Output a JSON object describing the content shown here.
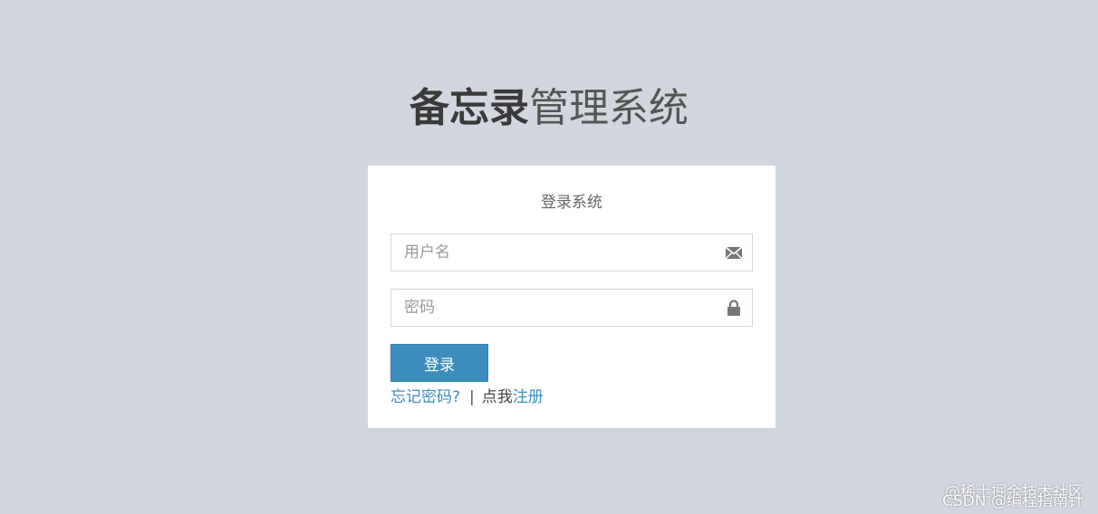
{
  "logo": {
    "bold": "备忘录",
    "light": "管理系统"
  },
  "login_box": {
    "message": "登录系统",
    "username": {
      "placeholder": "用户名",
      "value": "",
      "icon": "envelope-icon"
    },
    "password": {
      "placeholder": "密码",
      "value": "",
      "icon": "lock-icon"
    },
    "login_label": "登录",
    "forgot_label": "忘记密码?",
    "separator": "|",
    "register_prefix": "点我",
    "register_label": "注册"
  },
  "watermark": {
    "line1": "@稀土掘金技术社区",
    "line2": "CSDN @编程指南针"
  },
  "colors": {
    "background": "#d2d6de",
    "primary": "#3c8dbc",
    "box": "#ffffff"
  }
}
